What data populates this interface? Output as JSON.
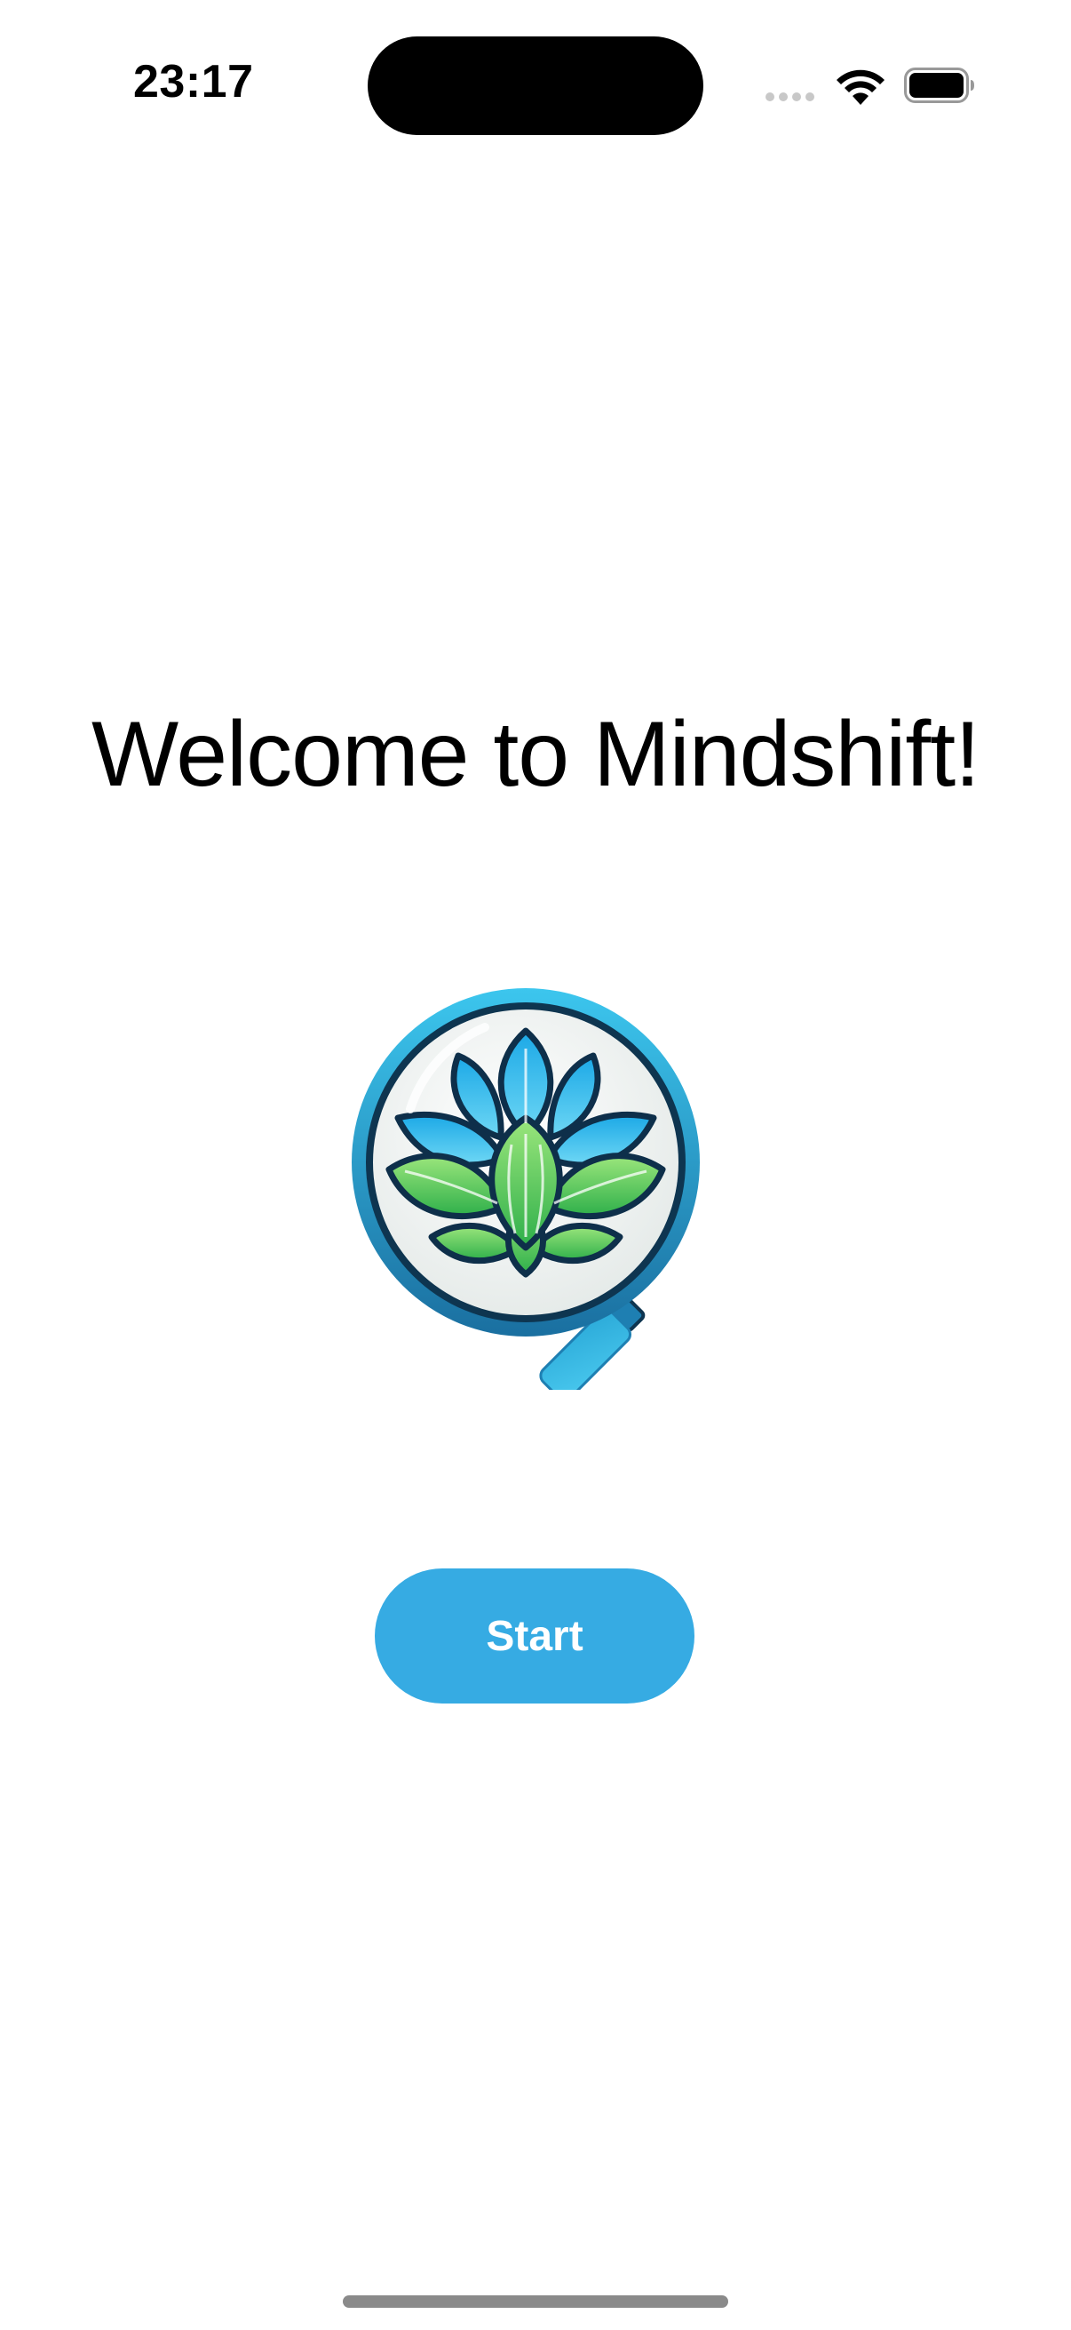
{
  "status_bar": {
    "time": "23:17",
    "icons": [
      "cellular-signal-icon",
      "wifi-icon",
      "battery-icon"
    ]
  },
  "main": {
    "title": "Welcome to Mindshift!",
    "logo_icon": "lotus-magnifier-logo",
    "start_button_label": "Start"
  },
  "colors": {
    "accent": "#36ABE3",
    "logo_blue": "#2DB6E8",
    "logo_green": "#5CCB4E",
    "background": "#FFFFFF"
  }
}
